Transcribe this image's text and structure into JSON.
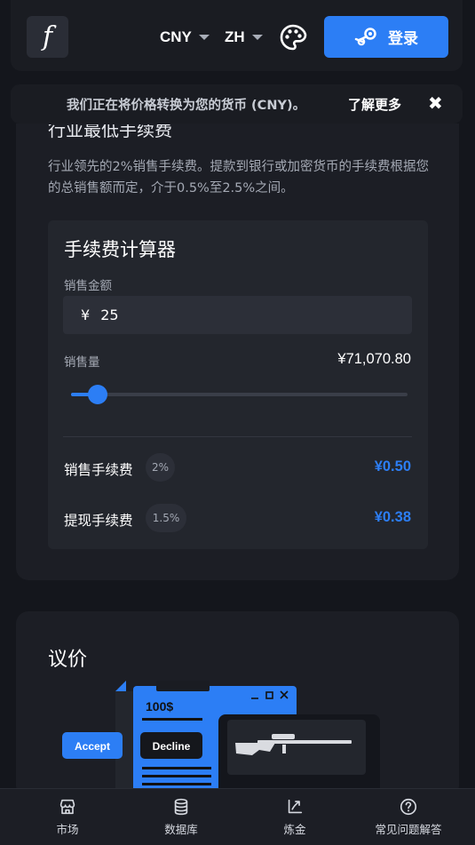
{
  "header": {
    "logo": "f",
    "currency": "CNY",
    "language": "ZH",
    "login_label": "登录"
  },
  "banner": {
    "text": "我们正在将价格转换为您的货币 (CNY)。",
    "learn_more": "了解更多",
    "close": "✖"
  },
  "fees_section": {
    "title": "行业最低手续费",
    "description": "行业领先的2%销售手续费。提款到银行或加密货币的手续费根据您的总销售额而定，介于0.5%至2.5%之间。"
  },
  "calculator": {
    "title": "手续费计算器",
    "amount_label": "销售金额",
    "currency_symbol": "¥",
    "amount_value": "25",
    "volume_label": "销售量",
    "volume_value": "¥71,070.80",
    "slider_fraction": 0.08,
    "sale_fee_label": "销售手续费",
    "sale_fee_rate": "2%",
    "sale_fee_value": "¥0.50",
    "withdraw_fee_label": "提现手续费",
    "withdraw_fee_rate": "1.5%",
    "withdraw_fee_value": "¥0.38"
  },
  "negotiation": {
    "title": "议价",
    "offer_amount": "100$",
    "accept_label": "Accept",
    "decline_label": "Decline"
  },
  "bottom_nav": [
    {
      "label": "市场",
      "icon": "store-icon"
    },
    {
      "label": "数据库",
      "icon": "database-icon"
    },
    {
      "label": "炼金",
      "icon": "alchemy-icon"
    },
    {
      "label": "常见问题解答",
      "icon": "help-icon"
    }
  ],
  "colors": {
    "accent": "#2c7ef5",
    "background": "#14161c",
    "card": "#1c1e25"
  }
}
